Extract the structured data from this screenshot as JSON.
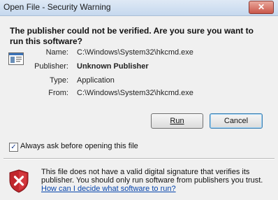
{
  "window": {
    "title": "Open File - Security Warning",
    "close_glyph": "✕"
  },
  "headline": "The publisher could not be verified.  Are you sure you want to run this software?",
  "file_icon": "application-window-icon",
  "details": [
    {
      "label": "Name:",
      "value": "C:\\Windows\\System32\\hkcmd.exe"
    },
    {
      "label": "Publisher:",
      "value": "Unknown Publisher"
    },
    {
      "label": "Type:",
      "value": "Application"
    },
    {
      "label": "From:",
      "value": "C:\\Windows\\System32\\hkcmd.exe"
    }
  ],
  "buttons": {
    "run": {
      "label": "Run",
      "accesskey": "R"
    },
    "cancel": {
      "label": "Cancel"
    }
  },
  "checkbox": {
    "label": "Always ask before opening this file",
    "checked": true,
    "check_glyph": "✓"
  },
  "warning": {
    "icon": "red-shield-x-icon",
    "text": "This file does not have a valid digital signature that verifies its publisher.  You should only run software from publishers you trust.",
    "link": "How can I decide what software to run?"
  },
  "colors": {
    "link": "#0645ad",
    "shield_red": "#c1272d",
    "title_bar": "#c5d8ee"
  }
}
